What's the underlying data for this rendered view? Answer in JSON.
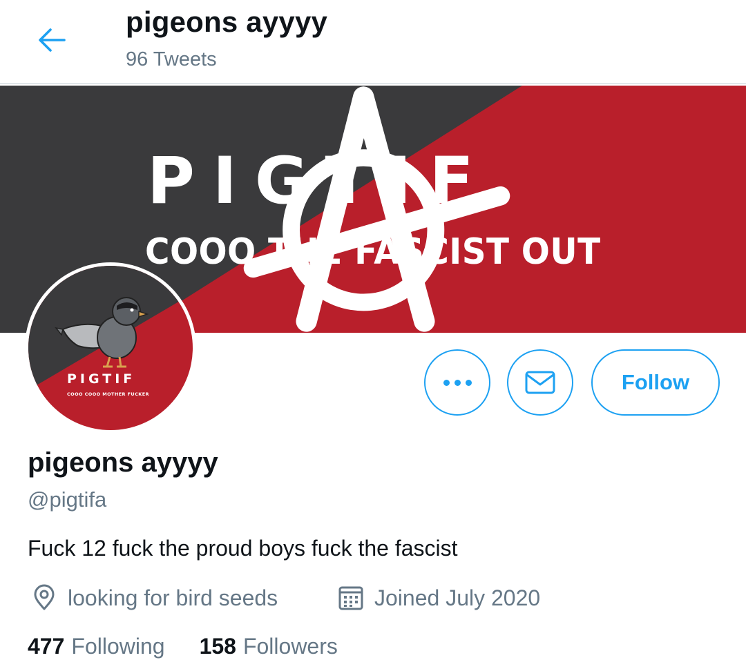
{
  "header": {
    "title": "pigeons ayyyy",
    "tweet_count": "96 Tweets",
    "back_icon": "arrow-left-icon"
  },
  "banner": {
    "title": "PIGTIF",
    "slogan": "COOO THE FASCIST OUT",
    "colors": {
      "dark": "#3a3a3c",
      "red": "#b91f2b"
    }
  },
  "avatar": {
    "title": "PIGTIF",
    "subtitle": "COOO COOO MOTHER FUCKER"
  },
  "actions": {
    "more_icon": "more-dots-icon",
    "message_icon": "envelope-icon",
    "follow_label": "Follow"
  },
  "profile": {
    "display_name": "pigeons ayyyy",
    "handle": "@pigtifa",
    "bio": "Fuck 12 fuck the proud boys fuck the fascist",
    "location": "looking for bird seeds",
    "joined": "Joined July 2020",
    "location_icon": "location-pin-icon",
    "joined_icon": "calendar-icon"
  },
  "stats": {
    "following_count": "477",
    "following_label": "Following",
    "followers_count": "158",
    "followers_label": "Followers"
  },
  "theme": {
    "accent": "#1da1f2",
    "muted_text": "#657786",
    "text": "#0f1419"
  }
}
